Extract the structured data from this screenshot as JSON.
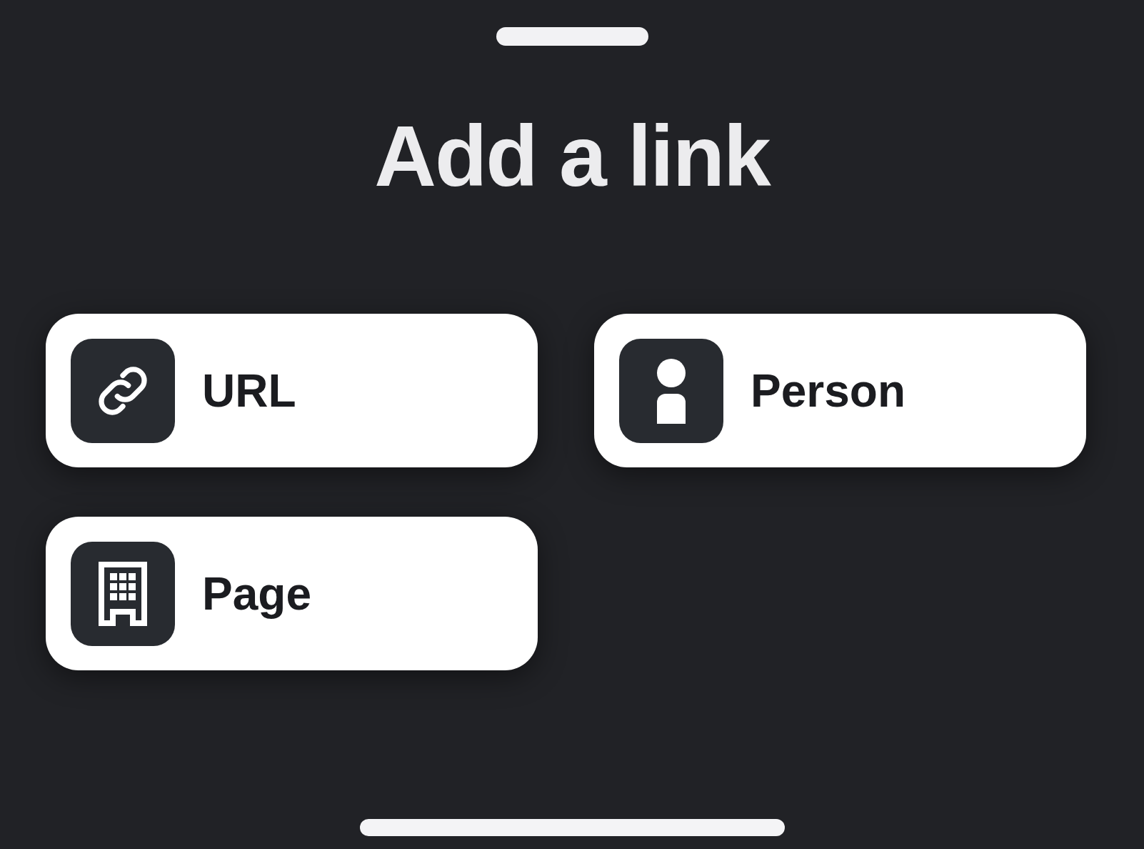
{
  "title": "Add a link",
  "options": [
    {
      "kind": "url",
      "label": "URL"
    },
    {
      "kind": "person",
      "label": "Person"
    },
    {
      "kind": "page",
      "label": "Page"
    }
  ]
}
